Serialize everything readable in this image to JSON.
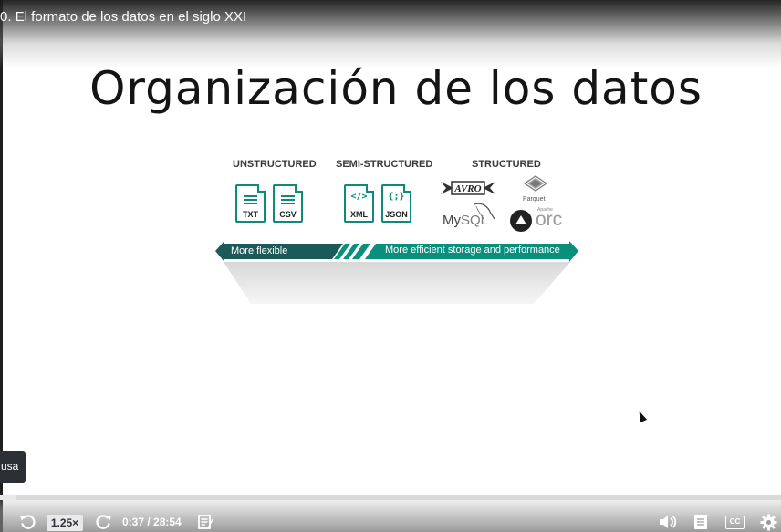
{
  "video": {
    "title": "0. El formato de los datos en el siglo XXI"
  },
  "slide": {
    "title": "Organización de los datos",
    "categories": {
      "unstructured": "UNSTRUCTURED",
      "semi_structured": "SEMI-STRUCTURED",
      "structured": "STRUCTURED"
    },
    "file_types": {
      "txt": "TXT",
      "csv": "CSV",
      "xml": "XML",
      "xml_glyph": "</>",
      "json": "JSON",
      "json_glyph": "{;}"
    },
    "logos": {
      "avro": "AVRO",
      "parquet": "Parquet",
      "mysql_my": "My",
      "mysql_sql": "SQL",
      "apache": "Apache",
      "orc": "orc"
    },
    "arrow": {
      "left_label": "More flexible",
      "right_label": "More efficient storage and performance",
      "dark_color": "#1c5a5a",
      "light_color": "#0b8f7d"
    }
  },
  "overlay": {
    "pause_tooltip": "usa"
  },
  "controls": {
    "playback_rate": "1.25×",
    "time": "0:37 / 28:54",
    "progress": 0.021,
    "cc_label": "CC",
    "icons": [
      "rewind-icon",
      "forward-icon",
      "transcript-icon",
      "volume-icon",
      "notes-icon",
      "captions-icon",
      "settings-gear-icon"
    ]
  }
}
